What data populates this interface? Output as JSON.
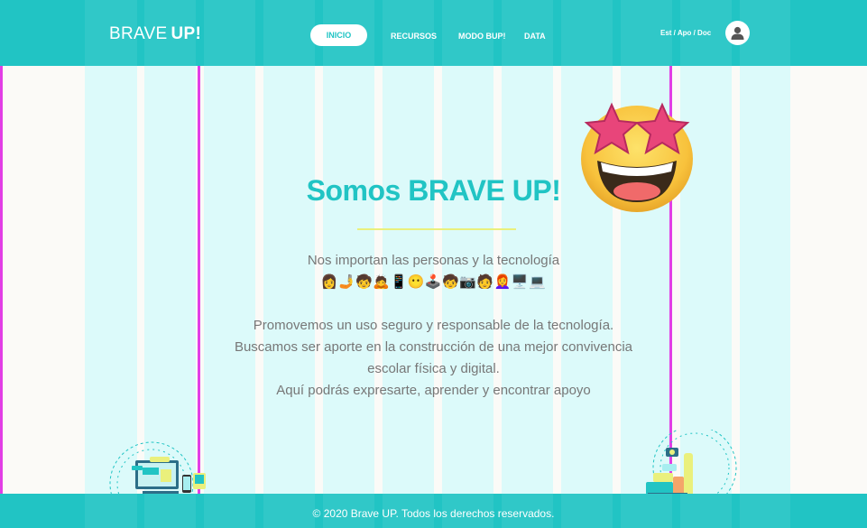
{
  "header": {
    "logo_light": "BRAVE",
    "logo_bold": "UP!",
    "nav": {
      "inicio": "INICIO",
      "recursos": "RECURSOS",
      "modo": "MODO BUP!",
      "data": "DATA"
    },
    "roles": "Est / Apo / Doc"
  },
  "main": {
    "title": "Somos BRAVE UP!",
    "subtitle": "Nos importan las personas y la tecnología",
    "emojis": "👩🤳🧒🙇📱😶🕹️🧒📷🧑👩‍🦰🖥️💻",
    "paragraph": [
      "Promovemos un uso seguro y responsable de la tecnología.",
      "Buscamos ser aporte en la construcción de una mejor convivencia",
      "escolar física y digital.",
      "Aquí podrás expresarte, aprender y encontrar apoyo"
    ]
  },
  "footer": {
    "copyright": "© 2020 Brave UP. Todos los derechos reservados."
  },
  "colors": {
    "primary": "#21c4c4",
    "column_tint": "#dcfafa",
    "guide_line": "#e23ee6",
    "text_gray": "#777777",
    "divider": "#eaf07c"
  },
  "icons": {
    "avatar": "user-icon",
    "hero": "star-struck-emoji"
  }
}
